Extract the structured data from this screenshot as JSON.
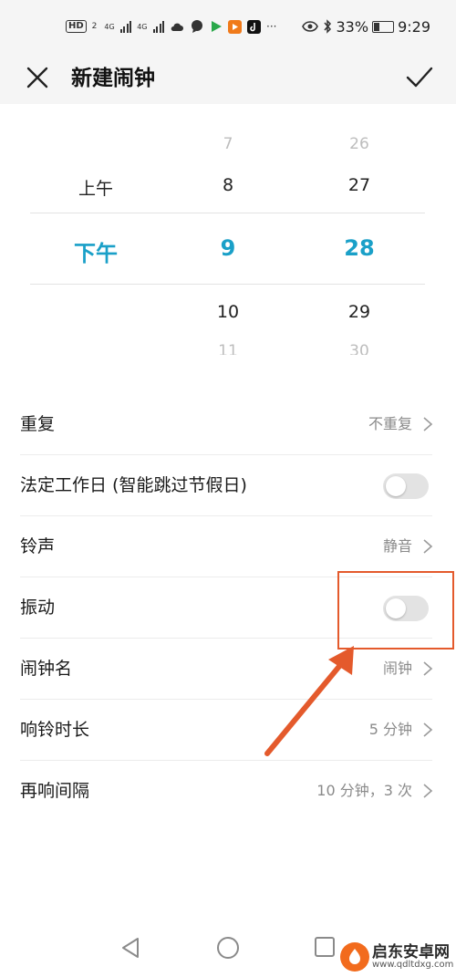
{
  "status_bar": {
    "hd_label": "HD",
    "hd_sub": "2",
    "network_1": "4G",
    "network_2": "4G",
    "more": "···",
    "battery": "33%",
    "time": "9:29"
  },
  "header": {
    "title": "新建闹钟",
    "close_icon": "close-icon",
    "confirm_icon": "check-icon"
  },
  "picker": {
    "period": {
      "above": "上午",
      "selected": "下午"
    },
    "hour": {
      "far_above": "7",
      "above": "8",
      "selected": "9",
      "below": "10",
      "far_below": "11"
    },
    "minute": {
      "far_above": "26",
      "above": "27",
      "selected": "28",
      "below": "29",
      "far_below": "30"
    }
  },
  "settings": {
    "repeat": {
      "label": "重复",
      "value": "不重复"
    },
    "workday": {
      "label": "法定工作日 (智能跳过节假日)",
      "enabled": false
    },
    "ringtone": {
      "label": "铃声",
      "value": "静音"
    },
    "vibrate": {
      "label": "振动",
      "enabled": false
    },
    "alarm_name": {
      "label": "闹钟名",
      "value": "闹钟"
    },
    "ring_duration": {
      "label": "响铃时长",
      "value": "5 分钟"
    },
    "snooze": {
      "label": "再响间隔",
      "value": "10 分钟，3 次"
    }
  },
  "colors": {
    "accent": "#1aa0c8",
    "annotation": "#e45a2c"
  },
  "watermark": {
    "title": "启东安卓网",
    "url": "www.qdltdxg.com"
  }
}
